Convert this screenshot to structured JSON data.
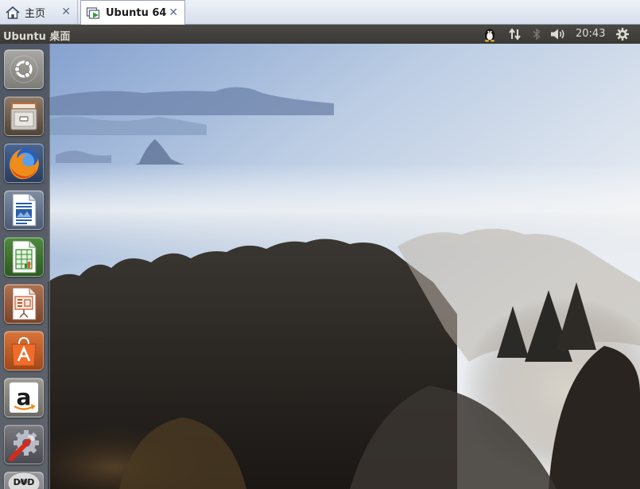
{
  "host_tabs": [
    {
      "label": "主页",
      "icon": "home-icon"
    },
    {
      "label": "Ubuntu 64",
      "icon": "vm-play-icon"
    }
  ],
  "panel": {
    "title": "Ubuntu 桌面",
    "clock": "20:43",
    "indicators": [
      "tux-icon",
      "network-updown-icon",
      "bluetooth-icon",
      "volume-icon",
      "gear-icon"
    ]
  },
  "launcher": [
    {
      "name": "dash-home",
      "icon": "ubuntu-logo-icon"
    },
    {
      "name": "files",
      "icon": "file-cabinet-icon"
    },
    {
      "name": "firefox",
      "icon": "firefox-icon"
    },
    {
      "name": "libreoffice-writer",
      "icon": "writer-document-icon"
    },
    {
      "name": "libreoffice-calc",
      "icon": "calc-spreadsheet-icon"
    },
    {
      "name": "libreoffice-impress",
      "icon": "impress-presentation-icon"
    },
    {
      "name": "software-center",
      "icon": "shopping-bag-icon"
    },
    {
      "name": "amazon",
      "icon": "amazon-icon"
    },
    {
      "name": "system-settings",
      "icon": "wrench-gear-icon"
    },
    {
      "name": "dvd",
      "icon": "dvd-icon",
      "label": "DVD"
    }
  ]
}
